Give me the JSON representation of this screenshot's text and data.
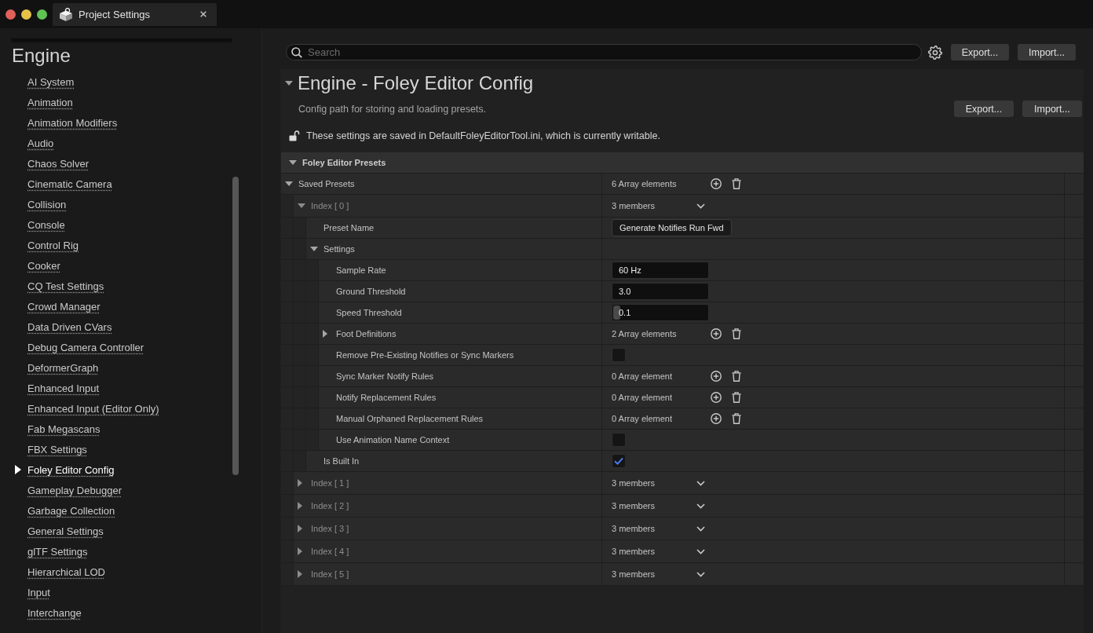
{
  "tab": {
    "title": "Project Settings"
  },
  "sidebar": {
    "heading": "Engine",
    "items": [
      {
        "label": "AI System",
        "selected": false
      },
      {
        "label": "Animation",
        "selected": false
      },
      {
        "label": "Animation Modifiers",
        "selected": false
      },
      {
        "label": "Audio",
        "selected": false
      },
      {
        "label": "Chaos Solver",
        "selected": false
      },
      {
        "label": "Cinematic Camera",
        "selected": false
      },
      {
        "label": "Collision",
        "selected": false
      },
      {
        "label": "Console",
        "selected": false
      },
      {
        "label": "Control Rig",
        "selected": false
      },
      {
        "label": "Cooker",
        "selected": false
      },
      {
        "label": "CQ Test Settings",
        "selected": false
      },
      {
        "label": "Crowd Manager",
        "selected": false
      },
      {
        "label": "Data Driven CVars",
        "selected": false
      },
      {
        "label": "Debug Camera Controller",
        "selected": false
      },
      {
        "label": "DeformerGraph",
        "selected": false
      },
      {
        "label": "Enhanced Input",
        "selected": false
      },
      {
        "label": "Enhanced Input (Editor Only)",
        "selected": false
      },
      {
        "label": "Fab Megascans",
        "selected": false
      },
      {
        "label": "FBX Settings",
        "selected": false
      },
      {
        "label": "Foley Editor Config",
        "selected": true
      },
      {
        "label": "Gameplay Debugger",
        "selected": false
      },
      {
        "label": "Garbage Collection",
        "selected": false
      },
      {
        "label": "General Settings",
        "selected": false
      },
      {
        "label": "glTF Settings",
        "selected": false
      },
      {
        "label": "Hierarchical LOD",
        "selected": false
      },
      {
        "label": "Input",
        "selected": false
      },
      {
        "label": "Interchange",
        "selected": false
      }
    ]
  },
  "toolbar": {
    "search": {
      "placeholder": "Search"
    },
    "buttons": [
      "Export...",
      "Import..."
    ]
  },
  "details": {
    "title": "Engine - Foley Editor Config",
    "expanded": true,
    "description": "Config path for storing and loading presets.",
    "buttons": [
      "Export...",
      "Import..."
    ],
    "notice": {
      "text": "These settings are saved in DefaultFoleyEditorTool.ini, which is currently writable.",
      "locked": false
    },
    "category": {
      "name": "Foley Editor Presets",
      "expanded": true
    },
    "properties": [
      {
        "name": "Saved Presets",
        "kind": "array",
        "expanded": true,
        "value": "6 Array elements",
        "children": [
          {
            "name": "Index [ 0 ]",
            "kind": "element",
            "expanded": true,
            "value": "3 members",
            "children": [
              {
                "name": "Preset Name",
                "kind": "text",
                "value": "Generate Notifies Run Fwd"
              },
              {
                "name": "Settings",
                "kind": "group",
                "expanded": true,
                "children": [
                  {
                    "name": "Sample Rate",
                    "kind": "field",
                    "value": "60 Hz"
                  },
                  {
                    "name": "Ground Threshold",
                    "kind": "field",
                    "value": "3.0"
                  },
                  {
                    "name": "Speed Threshold",
                    "kind": "slider",
                    "value": "0.1",
                    "level": 0.04
                  },
                  {
                    "name": "Foot Definitions",
                    "kind": "array",
                    "expanded": false,
                    "value": "2 Array elements"
                  },
                  {
                    "name": "Remove Pre-Existing Notifies or Sync Markers",
                    "kind": "checkbox",
                    "checked": false
                  },
                  {
                    "name": "Sync Marker Notify Rules",
                    "kind": "array",
                    "value": "0 Array element"
                  },
                  {
                    "name": "Notify Replacement Rules",
                    "kind": "array",
                    "value": "0 Array element"
                  },
                  {
                    "name": "Manual Orphaned Replacement Rules",
                    "kind": "array",
                    "value": "0 Array element"
                  },
                  {
                    "name": "Use Animation Name Context",
                    "kind": "checkbox",
                    "checked": false
                  }
                ]
              },
              {
                "name": "Is Built In",
                "kind": "checkbox",
                "checked": true
              }
            ]
          },
          {
            "name": "Index [ 1 ]",
            "kind": "element",
            "expanded": false,
            "value": "3 members"
          },
          {
            "name": "Index [ 2 ]",
            "kind": "element",
            "expanded": false,
            "value": "3 members"
          },
          {
            "name": "Index [ 3 ]",
            "kind": "element",
            "expanded": false,
            "value": "3 members"
          },
          {
            "name": "Index [ 4 ]",
            "kind": "element",
            "expanded": false,
            "value": "3 members"
          },
          {
            "name": "Index [ 5 ]",
            "kind": "element",
            "expanded": false,
            "value": "3 members"
          }
        ]
      }
    ]
  }
}
